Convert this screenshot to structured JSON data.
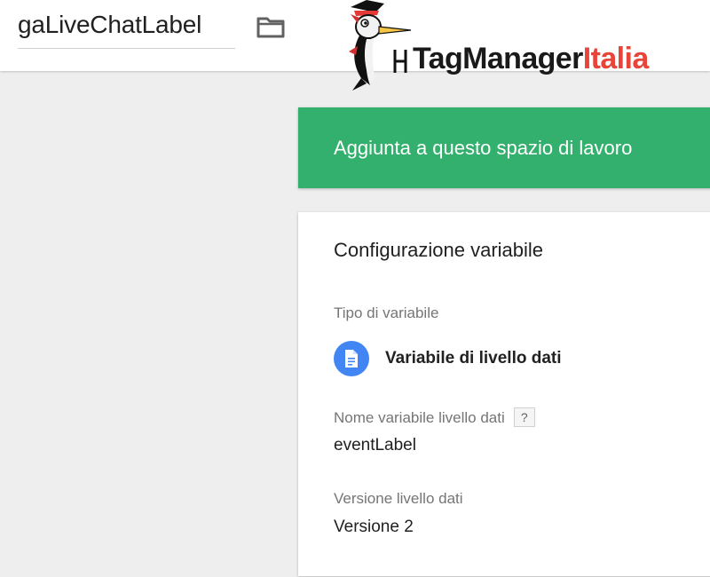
{
  "header": {
    "variable_name": "gaLiveChatLabel",
    "folder_icon": "folder-icon"
  },
  "logo": {
    "icon": "woodpecker-mascot",
    "brand_part1": "TagManager",
    "brand_part2": "Italia",
    "colors": {
      "dark": "#1a1a1a",
      "red": "#e8443a"
    }
  },
  "banner": {
    "label": "Aggiunta a questo spazio di lavoro",
    "color": "#33b06d"
  },
  "config": {
    "title": "Configurazione variabile",
    "type_label": "Tipo di variabile",
    "type_value": "Variabile di livello dati",
    "type_icon": "document-icon",
    "type_icon_color": "#4285f4",
    "dl_name_label": "Nome variabile livello dati",
    "help_label": "?",
    "dl_name_value": "eventLabel",
    "dl_version_label": "Versione livello dati",
    "dl_version_value": "Versione 2"
  }
}
